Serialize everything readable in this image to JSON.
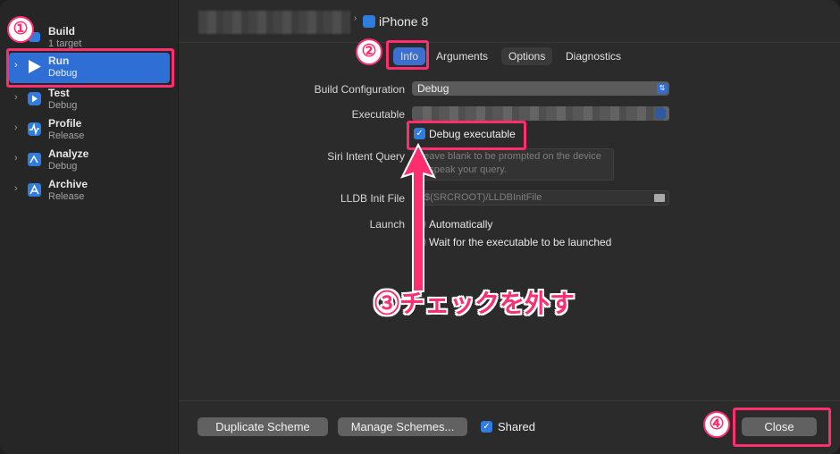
{
  "sidebar": {
    "items": [
      {
        "title": "Build",
        "subtitle": "1 target",
        "icon": "hammer-icon"
      },
      {
        "title": "Run",
        "subtitle": "Debug",
        "icon": "play-icon"
      },
      {
        "title": "Test",
        "subtitle": "Debug",
        "icon": "test-icon"
      },
      {
        "title": "Profile",
        "subtitle": "Release",
        "icon": "profile-icon"
      },
      {
        "title": "Analyze",
        "subtitle": "Debug",
        "icon": "analyze-icon"
      },
      {
        "title": "Archive",
        "subtitle": "Release",
        "icon": "archive-icon"
      }
    ]
  },
  "header": {
    "device": "iPhone 8"
  },
  "tabs": [
    "Info",
    "Arguments",
    "Options",
    "Diagnostics"
  ],
  "form": {
    "build_config_label": "Build Configuration",
    "build_config_value": "Debug",
    "executable_label": "Executable",
    "debug_executable_label": "Debug executable",
    "siri_label": "Siri Intent Query",
    "siri_placeholder": "Leave blank to be prompted on the device to speak your query.",
    "lldb_label": "LLDB Init File",
    "lldb_placeholder": "$(SRCROOT)/LLDBInitFile",
    "launch_label": "Launch",
    "launch_auto": "Automatically",
    "launch_wait": "Wait for the executable to be launched"
  },
  "bottom": {
    "duplicate": "Duplicate Scheme",
    "manage": "Manage Schemes...",
    "shared": "Shared",
    "close": "Close"
  },
  "annotations": {
    "n1": "①",
    "n2": "②",
    "n4": "④",
    "instruction": "③チェックを外す"
  },
  "colors": {
    "accent": "#2f6fd5",
    "highlight": "#ff2e6e"
  }
}
